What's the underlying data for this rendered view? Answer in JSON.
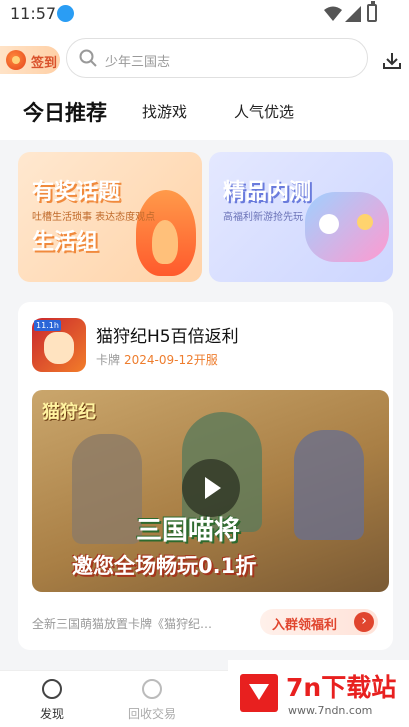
{
  "status": {
    "time": "11:57"
  },
  "header": {
    "signin_label": "签到",
    "search_placeholder": "少年三国志"
  },
  "tabs": [
    "今日推荐",
    "找游戏",
    "人气优选"
  ],
  "banners": [
    {
      "title": "有奖话题",
      "subtitle": "吐槽生活琐事 表达态度观点",
      "title2": "生活组"
    },
    {
      "title": "精品内测",
      "subtitle": "高福利新游抢先玩"
    }
  ],
  "game": {
    "icon_tag": "11.1h",
    "name": "猫狩纪H5百倍返利",
    "type": "卡牌",
    "date": "2024-09-12开服",
    "video_logo": "猫狩纪",
    "video_caption1": "三国喵将",
    "video_caption2": "邀您全场畅玩0.1折",
    "description": "全新三国萌猫放置卡牌《猫狩纪…",
    "join_label": "入群领福利"
  },
  "bottom_nav": [
    "发现",
    "回收交易"
  ],
  "watermark": {
    "name": "7n下载站",
    "url": "www.7ndn.com"
  },
  "colors": {
    "accent": "#e0452e",
    "date": "#ee7d2e"
  }
}
